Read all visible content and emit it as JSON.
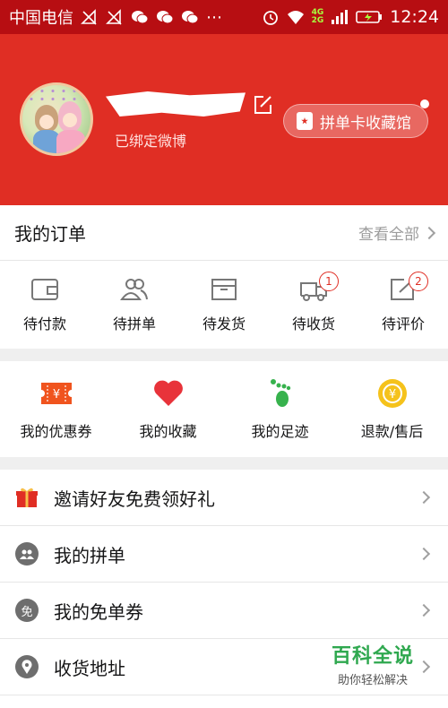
{
  "status_bar": {
    "carrier": "中国电信",
    "network_top": "4G",
    "network_bottom": "2G",
    "time": "12:24"
  },
  "profile": {
    "bound_text": "已绑定微博",
    "collect_button": "拼单卡收藏馆"
  },
  "orders": {
    "title": "我的订单",
    "view_all": "查看全部",
    "items": [
      {
        "label": "待付款",
        "icon": "wallet-icon"
      },
      {
        "label": "待拼单",
        "icon": "group-icon"
      },
      {
        "label": "待发货",
        "icon": "box-icon"
      },
      {
        "label": "待收货",
        "icon": "truck-icon",
        "badge": "1"
      },
      {
        "label": "待评价",
        "icon": "review-icon",
        "badge": "2"
      }
    ]
  },
  "shortcuts": [
    {
      "label": "我的优惠券",
      "icon": "coupon-icon"
    },
    {
      "label": "我的收藏",
      "icon": "heart-icon"
    },
    {
      "label": "我的足迹",
      "icon": "footprint-icon"
    },
    {
      "label": "退款/售后",
      "icon": "refund-icon"
    }
  ],
  "list": [
    {
      "label": "邀请好友免费领好礼",
      "icon": "gift-icon"
    },
    {
      "label": "我的拼单",
      "icon": "group-buy-icon"
    },
    {
      "label": "我的免单券",
      "icon": "free-coupon-icon",
      "icon_text": "免"
    },
    {
      "label": "收货地址",
      "icon": "location-icon"
    }
  ],
  "watermark": {
    "title": "百科全说",
    "subtitle": "助你轻松解决"
  },
  "colors": {
    "brand_red": "#e02e24",
    "status_bar": "#b70e12",
    "coupon_orange": "#f0541e",
    "heart_red": "#e8333a",
    "footprint_green": "#37b24d",
    "refund_yellow": "#f5c21b"
  }
}
